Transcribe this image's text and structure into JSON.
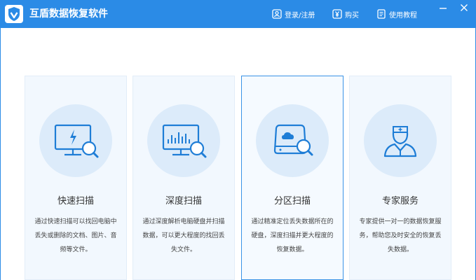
{
  "app": {
    "title": "互盾数据恢复软件"
  },
  "header": {
    "login_label": "登录/注册",
    "buy_label": "购买",
    "tutorial_label": "使用教程"
  },
  "colors": {
    "accent": "#2b8be6",
    "card_bg": "#f2f8fe",
    "circle_bg": "#dcebfa"
  },
  "modes": [
    {
      "title": "快速扫描",
      "description": "通过快速扫描可以找回电脑中丢失或删除的文档、图片、音频等文件。",
      "icon": "monitor-bolt-search-icon"
    },
    {
      "title": "深度扫描",
      "description": "通过深度解析电脑硬盘并扫描数据，可以更大程度的找回丢失文件。",
      "icon": "monitor-chart-search-icon"
    },
    {
      "title": "分区扫描",
      "description": "通过精准定位丢失数据所在的硬盘，深度扫描并更大程度的恢复数据。",
      "icon": "drive-cloud-search-icon"
    },
    {
      "title": "专家服务",
      "description": "专家提供一对一的数据恢复服务，帮助您及时安全的恢复丢失数据。",
      "icon": "doctor-icon"
    }
  ]
}
